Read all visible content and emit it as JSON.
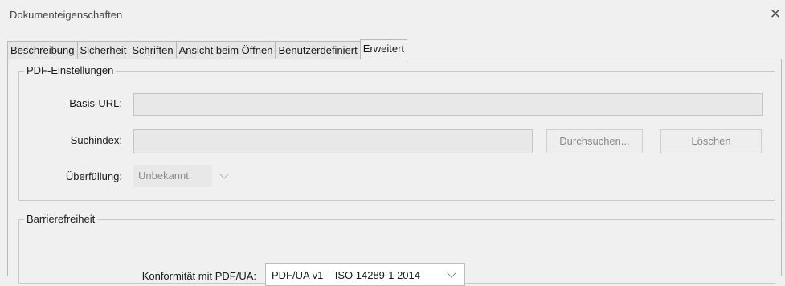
{
  "window": {
    "title": "Dokumenteigenschaften"
  },
  "tabs": [
    {
      "label": "Beschreibung"
    },
    {
      "label": "Sicherheit"
    },
    {
      "label": "Schriften"
    },
    {
      "label": "Ansicht beim Öffnen"
    },
    {
      "label": "Benutzerdefiniert"
    },
    {
      "label": "Erweitert",
      "active": true
    }
  ],
  "pdf_settings": {
    "legend": "PDF-Einstellungen",
    "base_url_label": "Basis-URL:",
    "base_url_value": "",
    "search_index_label": "Suchindex:",
    "search_index_value": "",
    "browse_label": "Durchsuchen...",
    "delete_label": "Löschen",
    "trapping_label": "Überfüllung:",
    "trapping_value": "Unbekannt"
  },
  "accessibility": {
    "legend": "Barrierefreiheit",
    "conformance_label": "Konformität mit PDF/UA:",
    "conformance_value": "PDF/UA v1 – ISO 14289-1 2014"
  },
  "icons": {
    "close": "close-icon",
    "dropdown": "chevron-down-icon"
  }
}
